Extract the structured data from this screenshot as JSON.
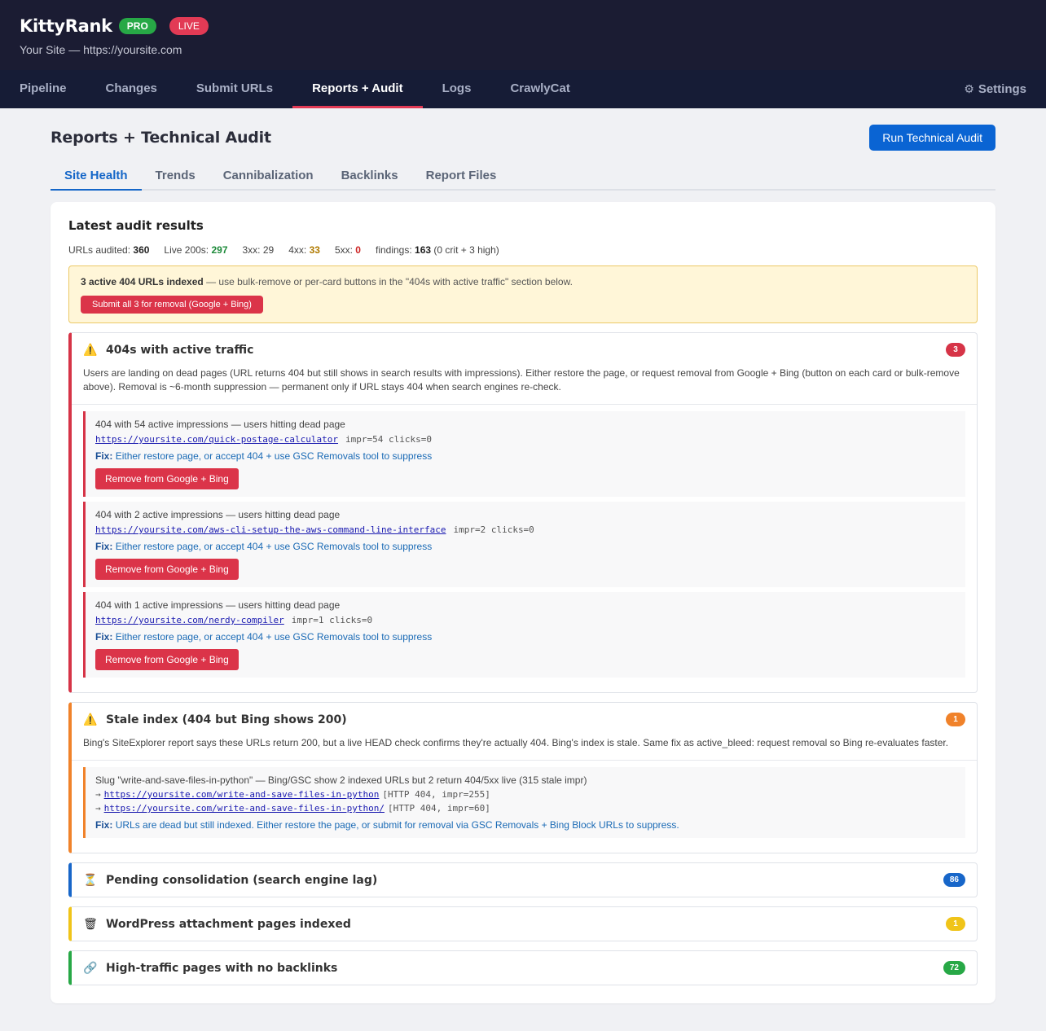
{
  "header": {
    "brand": "KittyRank",
    "pro_badge": "PRO",
    "live_badge": "LIVE",
    "site": "Your Site — https://yoursite.com"
  },
  "nav": {
    "items": [
      "Pipeline",
      "Changes",
      "Submit URLs",
      "Reports + Audit",
      "Logs",
      "CrawlyCat"
    ],
    "active": "Reports + Audit",
    "settings_icon": "gear-icon",
    "settings": "Settings"
  },
  "page": {
    "title": "Reports + Technical Audit",
    "run_button": "Run Technical Audit",
    "subtabs": [
      "Site Health",
      "Trends",
      "Cannibalization",
      "Backlinks",
      "Report Files"
    ],
    "active_subtab": "Site Health"
  },
  "audit": {
    "title": "Latest audit results",
    "stats": {
      "audited_label": "URLs audited:",
      "audited": "360",
      "live_label": "Live 200s:",
      "live": "297",
      "x3_label": "3xx:",
      "x3": "29",
      "x4_label": "4xx:",
      "x4": "33",
      "x5_label": "5xx:",
      "x5": "0",
      "findings_label": "findings:",
      "findings": "163",
      "findings_detail": "(0 crit + 3 high)"
    },
    "alert": {
      "bold": "3 active 404 URLs indexed",
      "text": " — use bulk-remove or per-card buttons in the \"404s with active traffic\" section below.",
      "button": "Submit all 3 for removal (Google + Bing)"
    }
  },
  "sections": {
    "active_404": {
      "icon": "warning-icon",
      "title": "404s with active traffic",
      "count": "3",
      "desc": "Users are landing on dead pages (URL returns 404 but still shows in search results with impressions). Either restore the page, or request removal from Google + Bing (button on each card or bulk-remove above). Removal is ~6-month suppression — permanent only if URL stays 404 when search engines re-check.",
      "fix_label": "Fix:",
      "fix_text": "Either restore page, or accept 404 + use GSC Removals tool to suppress",
      "remove_label": "Remove from Google + Bing",
      "items": [
        {
          "title": "404 with 54 active impressions — users hitting dead page",
          "url": "https://yoursite.com/quick-postage-calculator",
          "meta": "impr=54 clicks=0"
        },
        {
          "title": "404 with 2 active impressions — users hitting dead page",
          "url": "https://yoursite.com/aws-cli-setup-the-aws-command-line-interface",
          "meta": "impr=2 clicks=0"
        },
        {
          "title": "404 with 1 active impressions — users hitting dead page",
          "url": "https://yoursite.com/nerdy-compiler",
          "meta": "impr=1 clicks=0"
        }
      ]
    },
    "stale": {
      "icon": "warning-icon",
      "title": "Stale index (404 but Bing shows 200)",
      "count": "1",
      "desc": "Bing's SiteExplorer report says these URLs return 200, but a live HEAD check confirms they're actually 404. Bing's index is stale. Same fix as active_bleed: request removal so Bing re-evaluates faster.",
      "item_title": "Slug \"write-and-save-files-in-python\" — Bing/GSC show 2 indexed URLs but 2 return 404/5xx live (315 stale impr)",
      "urls": [
        {
          "arrow": "→",
          "url": "https://yoursite.com/write-and-save-files-in-python",
          "meta": "[HTTP 404, impr=255]"
        },
        {
          "arrow": "→",
          "url": "https://yoursite.com/write-and-save-files-in-python/",
          "meta": "[HTTP 404, impr=60]"
        }
      ],
      "fix_label": "Fix:",
      "fix_text": "URLs are dead but still indexed. Either restore the page, or submit for removal via GSC Removals + Bing Block URLs to suppress."
    },
    "pending": {
      "icon": "hourglass-icon",
      "title": "Pending consolidation (search engine lag)",
      "count": "86"
    },
    "attachments": {
      "icon": "trash-icon",
      "title": "WordPress attachment pages indexed",
      "count": "1"
    },
    "backlinks": {
      "icon": "link-icon",
      "title": "High-traffic pages with no backlinks",
      "count": "72"
    }
  }
}
